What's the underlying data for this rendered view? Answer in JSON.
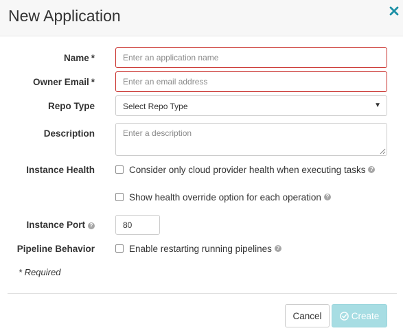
{
  "modal": {
    "title": "New Application",
    "close_icon": "close-icon",
    "accent_color": "#1a8fa5"
  },
  "form": {
    "name": {
      "label": "Name",
      "required_mark": "*",
      "placeholder": "Enter an application name",
      "value": ""
    },
    "owner_email": {
      "label": "Owner Email",
      "required_mark": "*",
      "placeholder": "Enter an email address",
      "value": ""
    },
    "repo_type": {
      "label": "Repo Type",
      "selected": "Select Repo Type",
      "caret_icon": "caret-down-icon"
    },
    "description": {
      "label": "Description",
      "placeholder": "Enter a description",
      "value": ""
    },
    "instance_health": {
      "label": "Instance Health",
      "options": [
        {
          "label": "Consider only cloud provider health when executing tasks",
          "checked": false
        },
        {
          "label": "Show health override option for each operation",
          "checked": false
        }
      ]
    },
    "instance_port": {
      "label": "Instance Port",
      "value": "80"
    },
    "pipeline_behavior": {
      "label": "Pipeline Behavior",
      "option": {
        "label": "Enable restarting running pipelines",
        "checked": false
      }
    },
    "required_note": "* Required",
    "invalid_border_color": "#c9302c"
  },
  "footer": {
    "cancel_label": "Cancel",
    "create_label": "Create",
    "create_color": "#a7dde3"
  }
}
